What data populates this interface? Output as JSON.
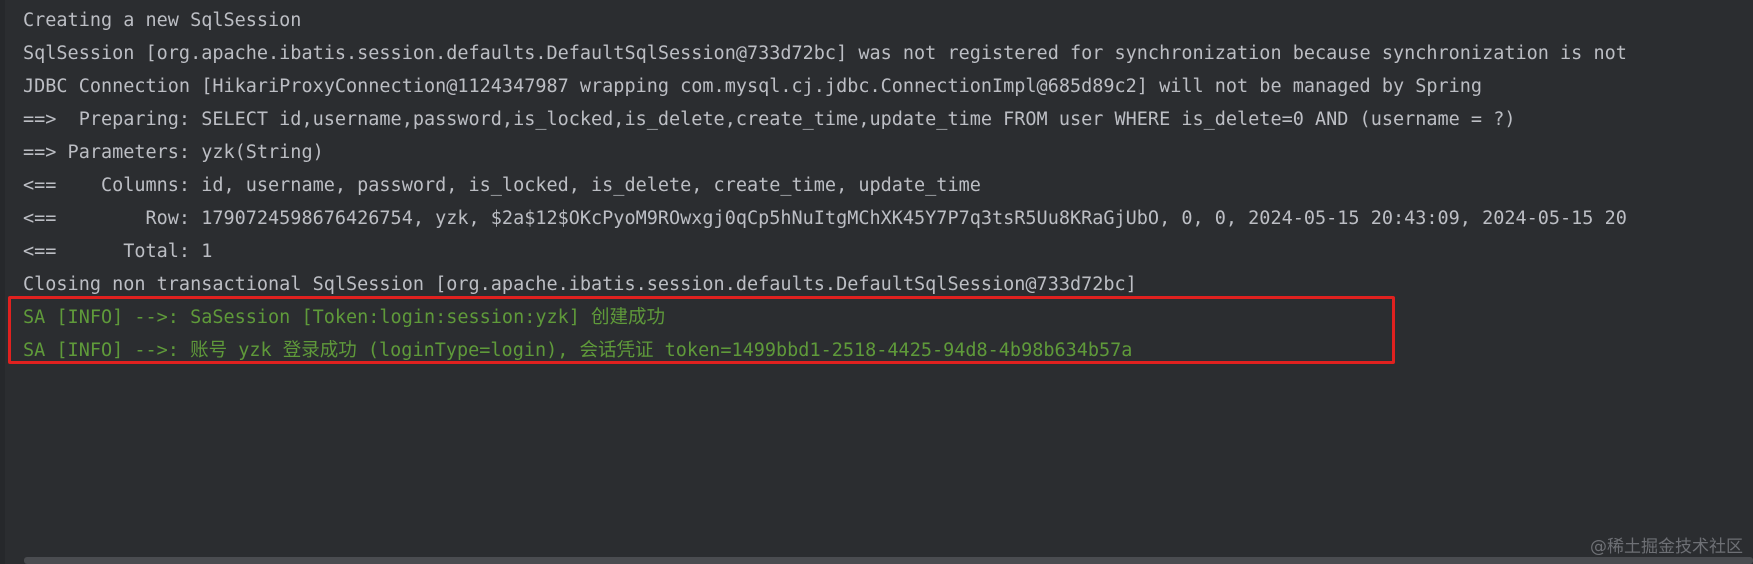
{
  "console": {
    "lines": [
      "Creating a new SqlSession",
      "SqlSession [org.apache.ibatis.session.defaults.DefaultSqlSession@733d72bc] was not registered for synchronization because synchronization is not",
      "JDBC Connection [HikariProxyConnection@1124347987 wrapping com.mysql.cj.jdbc.ConnectionImpl@685d89c2] will not be managed by Spring",
      "==>  Preparing: SELECT id,username,password,is_locked,is_delete,create_time,update_time FROM user WHERE is_delete=0 AND (username = ?)",
      "==> Parameters: yzk(String)",
      "<==    Columns: id, username, password, is_locked, is_delete, create_time, update_time",
      "<==        Row: 1790724598676426754, yzk, $2a$12$OKcPyoM9ROwxgj0qCp5hNuItgMChXK45Y7P7q3tsR5Uu8KRaGjUbO, 0, 0, 2024-05-15 20:43:09, 2024-05-15 20",
      "<==      Total: 1",
      "Closing non transactional SqlSession [org.apache.ibatis.session.defaults.DefaultSqlSession@733d72bc]"
    ],
    "info_lines": [
      "SA [INFO] -->: SaSession [Token:login:session:yzk] 创建成功",
      "SA [INFO] -->: 账号 yzk 登录成功 (loginType=login), 会话凭证 token=1499bbd1-2518-4425-94d8-4b98b634b57a"
    ],
    "colors": {
      "background": "#2b2d30",
      "default_text": "#bcbec4",
      "info_text": "#5f9a3a",
      "highlight_border": "#e0211f"
    }
  },
  "watermark": "@稀土掘金技术社区"
}
